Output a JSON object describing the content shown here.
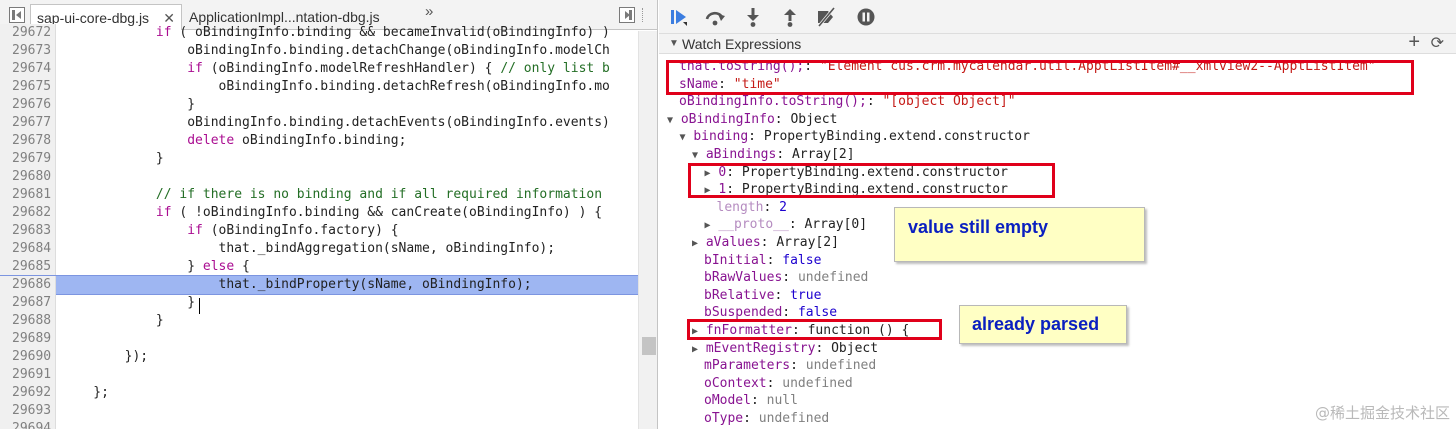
{
  "tabs": [
    {
      "label": "sap-ui-core-dbg.js",
      "close": "✕",
      "active": true
    },
    {
      "label": "ApplicationImpl...ntation-dbg.js",
      "active": false
    }
  ],
  "tab_overflow": "»",
  "code": {
    "lines": [
      {
        "n": "29672",
        "t": "            if ( oBindingInfo.binding && becameInvalid(oBindingInfo) )"
      },
      {
        "n": "29673",
        "t": "                oBindingInfo.binding.detachChange(oBindingInfo.modelCh"
      },
      {
        "n": "29674",
        "t": "                if (oBindingInfo.modelRefreshHandler) { // only list b"
      },
      {
        "n": "29675",
        "t": "                    oBindingInfo.binding.detachRefresh(oBindingInfo.mo"
      },
      {
        "n": "29676",
        "t": "                }"
      },
      {
        "n": "29677",
        "t": "                oBindingInfo.binding.detachEvents(oBindingInfo.events)"
      },
      {
        "n": "29678",
        "t": "                delete oBindingInfo.binding;"
      },
      {
        "n": "29679",
        "t": "            }"
      },
      {
        "n": "29680",
        "t": ""
      },
      {
        "n": "29681",
        "t": "            // if there is no binding and if all required information"
      },
      {
        "n": "29682",
        "t": "            if ( !oBindingInfo.binding && canCreate(oBindingInfo) ) {"
      },
      {
        "n": "29683",
        "t": "                if (oBindingInfo.factory) {"
      },
      {
        "n": "29684",
        "t": "                    that._bindAggregation(sName, oBindingInfo);"
      },
      {
        "n": "29685",
        "t": "                } else {"
      },
      {
        "n": "29686",
        "t": "                    that._bindProperty(sName, oBindingInfo);",
        "highlight": true
      },
      {
        "n": "29687",
        "t": "                }"
      },
      {
        "n": "29688",
        "t": "            }"
      },
      {
        "n": "29689",
        "t": ""
      },
      {
        "n": "29690",
        "t": "        });"
      },
      {
        "n": "29691",
        "t": ""
      },
      {
        "n": "29692",
        "t": "    };"
      },
      {
        "n": "29693",
        "t": ""
      },
      {
        "n": "29694",
        "t": ""
      }
    ]
  },
  "debugger_toolbar": [
    "resume-icon",
    "step-over-icon",
    "step-into-icon",
    "step-out-icon",
    "deactivate-breakpoints-icon",
    "pause-on-exceptions-icon"
  ],
  "watch": {
    "header": "Watch Expressions",
    "add": "+",
    "refresh": "C",
    "rows": [
      {
        "indent": 0,
        "arrow": "",
        "name": "that.toString();",
        "sep": ": ",
        "value": "\"Element cus.crm.mycalendar.util.ApptListItem#__xmlview2--ApptListItem\"",
        "vclass": "str"
      },
      {
        "indent": 0,
        "arrow": "",
        "name": "sName",
        "sep": ": ",
        "value": "\"time\"",
        "vclass": "str"
      },
      {
        "indent": 0,
        "arrow": "",
        "name": "oBindingInfo.toString();",
        "sep": ": ",
        "value": "\"[object Object]\"",
        "vclass": "str"
      },
      {
        "indent": 0,
        "arrow": "▼",
        "name": "oBindingInfo",
        "sep": ": ",
        "value": "Object",
        "vclass": "val"
      },
      {
        "indent": 1,
        "arrow": "▼",
        "name": "binding",
        "sep": ": ",
        "value": "PropertyBinding.extend.constructor",
        "vclass": "val"
      },
      {
        "indent": 2,
        "arrow": "▼",
        "name": "aBindings",
        "sep": ": ",
        "value": "Array[2]",
        "vclass": "val"
      },
      {
        "indent": 3,
        "arrow": "▶",
        "name": "0",
        "sep": ": ",
        "value": "PropertyBinding.extend.constructor",
        "vclass": "val"
      },
      {
        "indent": 3,
        "arrow": "▶",
        "name": "1",
        "sep": ": ",
        "value": "PropertyBinding.extend.constructor",
        "vclass": "val"
      },
      {
        "indent": 3,
        "arrow": "",
        "name": "length",
        "sep": ": ",
        "value": "2",
        "vclass": "num",
        "dim": true
      },
      {
        "indent": 3,
        "arrow": "▶",
        "name": "__proto__",
        "sep": ": ",
        "value": "Array[0]",
        "vclass": "val",
        "dim": true
      },
      {
        "indent": 2,
        "arrow": "▶",
        "name": "aValues",
        "sep": ": ",
        "value": "Array[2]",
        "vclass": "val"
      },
      {
        "indent": 2,
        "arrow": "",
        "name": "bInitial",
        "sep": ": ",
        "value": "false",
        "vclass": "num"
      },
      {
        "indent": 2,
        "arrow": "",
        "name": "bRawValues",
        "sep": ": ",
        "value": "undefined",
        "vclass": "gray"
      },
      {
        "indent": 2,
        "arrow": "",
        "name": "bRelative",
        "sep": ": ",
        "value": "true",
        "vclass": "num"
      },
      {
        "indent": 2,
        "arrow": "",
        "name": "bSuspended",
        "sep": ": ",
        "value": "false",
        "vclass": "num"
      },
      {
        "indent": 2,
        "arrow": "▶",
        "name": "fnFormatter",
        "sep": ": ",
        "value": "function () {",
        "vclass": "val"
      },
      {
        "indent": 2,
        "arrow": "▶",
        "name": "mEventRegistry",
        "sep": ": ",
        "value": "Object",
        "vclass": "val"
      },
      {
        "indent": 2,
        "arrow": "",
        "name": "mParameters",
        "sep": ": ",
        "value": "undefined",
        "vclass": "gray"
      },
      {
        "indent": 2,
        "arrow": "",
        "name": "oContext",
        "sep": ": ",
        "value": "undefined",
        "vclass": "gray"
      },
      {
        "indent": 2,
        "arrow": "",
        "name": "oModel",
        "sep": ": ",
        "value": "null",
        "vclass": "gray"
      },
      {
        "indent": 2,
        "arrow": "",
        "name": "oType",
        "sep": ": ",
        "value": "undefined",
        "vclass": "gray"
      }
    ]
  },
  "annotations": {
    "value_empty": "value still empty",
    "already_parsed": "already parsed"
  },
  "colors": {
    "annotation_box": "#e0001a",
    "note_bg": "#ffffc4",
    "note_text": "#0a1fc0",
    "highlight": "#9eb6f2"
  },
  "watermark": "@稀土掘金技术社区"
}
